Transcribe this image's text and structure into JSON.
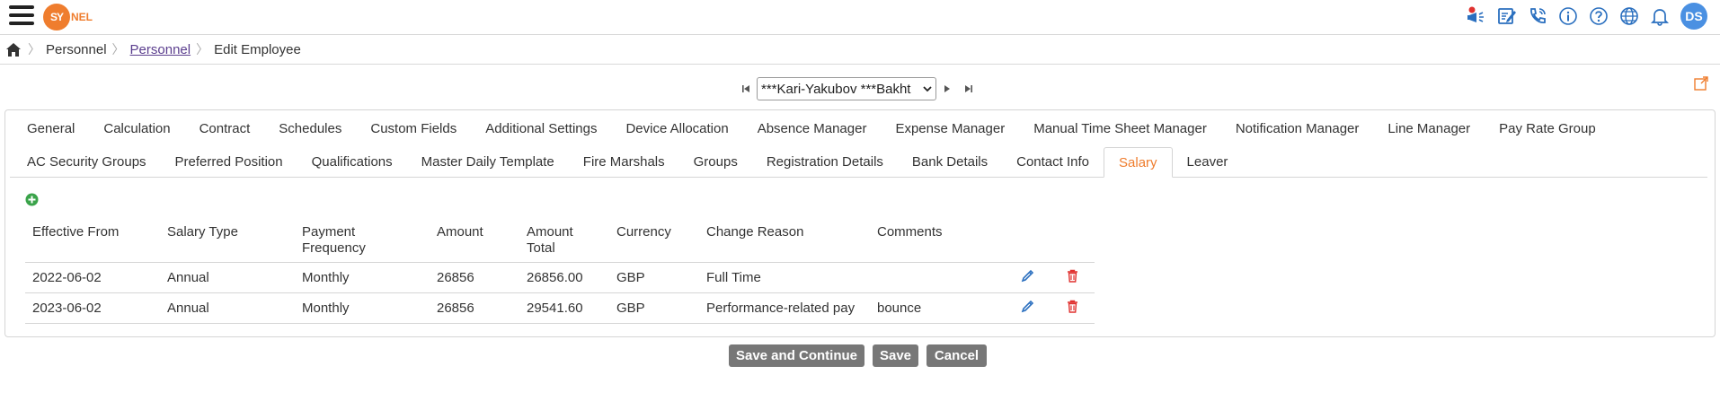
{
  "topbar": {
    "logo_text": "SY",
    "logo_tail": "NEL",
    "icons": [
      "announcement-icon",
      "edit-note-icon",
      "phone-icon",
      "info-icon",
      "help-icon",
      "globe-icon",
      "bell-icon"
    ],
    "avatar_initials": "DS",
    "accent": "#ef7d2e"
  },
  "breadcrumb": {
    "items": [
      "Personnel",
      "Personnel",
      "Edit Employee"
    ]
  },
  "navigator": {
    "selected_employee": "***Kari-Yakubov ***Bakht"
  },
  "tabs": {
    "row1": [
      "General",
      "Calculation",
      "Contract",
      "Schedules",
      "Custom Fields",
      "Additional Settings",
      "Device Allocation",
      "Absence Manager",
      "Expense Manager",
      "Manual Time Sheet Manager",
      "Notification Manager",
      "Line Manager",
      "Pay Rate Group"
    ],
    "row2": [
      "AC Security Groups",
      "Preferred Position",
      "Qualifications",
      "Master Daily Template",
      "Fire Marshals",
      "Groups",
      "Registration Details",
      "Bank Details",
      "Contact Info",
      "Salary",
      "Leaver"
    ],
    "active": "Salary"
  },
  "salary_table": {
    "headers": [
      "Effective From",
      "Salary Type",
      "Payment Frequency",
      "Amount",
      "Amount Total",
      "Currency",
      "Change Reason",
      "Comments"
    ],
    "rows": [
      [
        "2022-06-02",
        "Annual",
        "Monthly",
        "26856",
        "26856.00",
        "GBP",
        "Full Time",
        ""
      ],
      [
        "2023-06-02",
        "Annual",
        "Monthly",
        "26856",
        "29541.60",
        "GBP",
        "Performance-related pay",
        "bounce"
      ]
    ]
  },
  "buttons": {
    "save_continue": "Save and Continue",
    "save": "Save",
    "cancel": "Cancel"
  }
}
